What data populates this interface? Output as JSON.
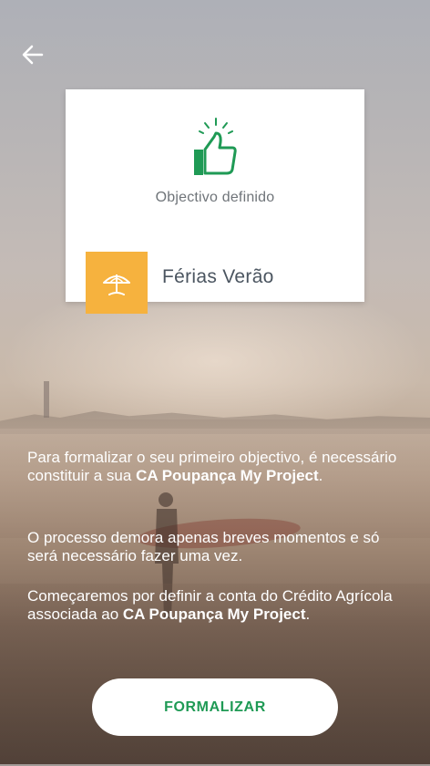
{
  "header": {
    "back_icon": "arrow-left-icon"
  },
  "card": {
    "status_icon": "thumbs-up-icon",
    "status_label": "Objectivo definido",
    "goal_icon": "beach-umbrella-icon",
    "goal_name": "Férias Verão",
    "accent_color": "#f6b23e",
    "thumb_color": "#1f9a55"
  },
  "body": {
    "p1_pre": "Para formalizar o seu primeiro objectivo, é necessário constituir a sua ",
    "p1_bold": "CA Poupança My Project",
    "p1_post": ".",
    "p2": "O processo demora apenas breves momentos e só será necessário fazer uma vez.",
    "p3_pre": "Começaremos por definir a conta do Crédito Agrícola associada ao ",
    "p3_bold": "CA Poupança My Project",
    "p3_post": "."
  },
  "cta": {
    "label": "FORMALIZAR"
  }
}
